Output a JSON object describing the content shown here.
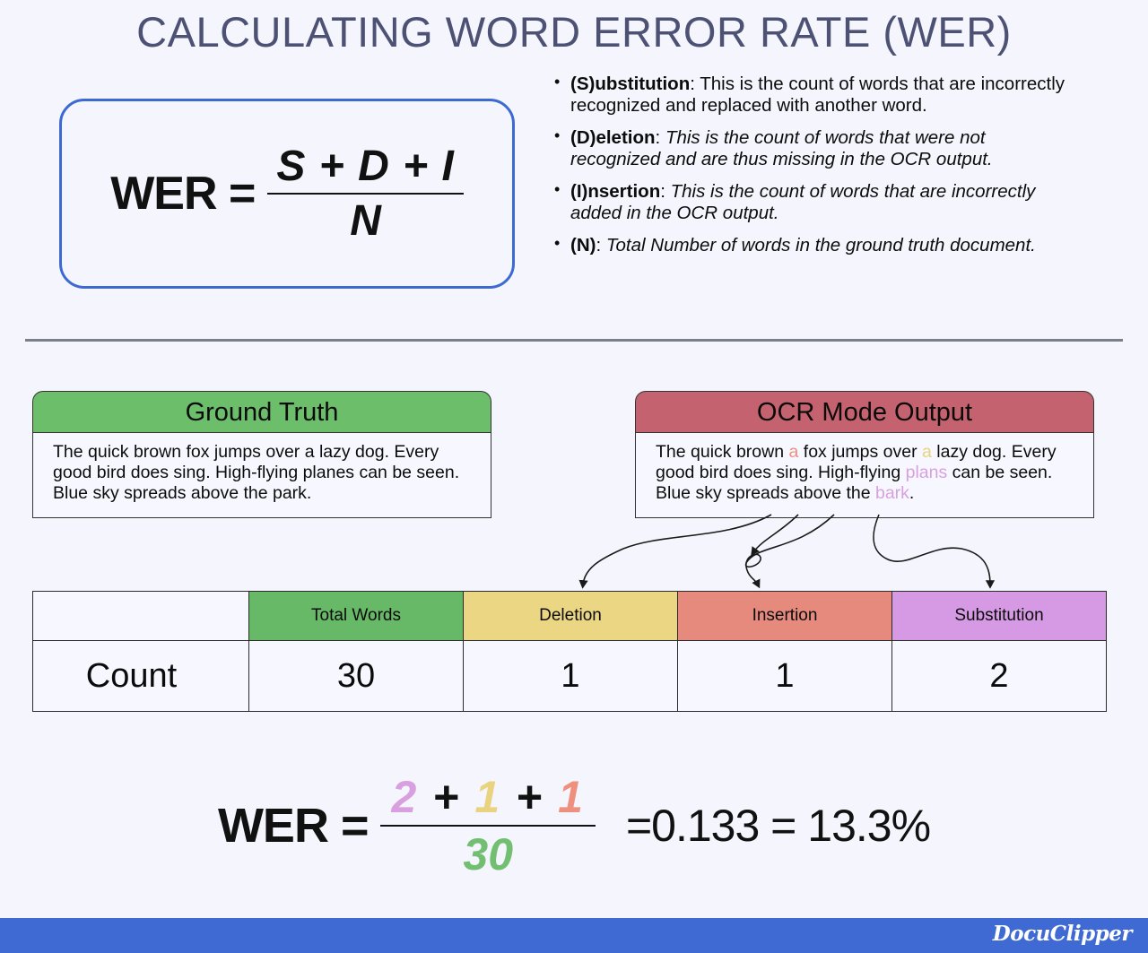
{
  "title": "CALCULATING WORD ERROR RATE (WER)",
  "formula": {
    "lhs": "WER =",
    "numerator": "S + D + I",
    "denominator": "N"
  },
  "definitions": [
    {
      "term": "(S)ubstitution",
      "sep": ": ",
      "desc": "This is the count of words that are incorrectly recognized and replaced with another word.",
      "italic": false
    },
    {
      "term": "(D)eletion",
      "sep": ": ",
      "desc": "This is the count of words that were not recognized and are thus missing in the OCR output.",
      "italic": true
    },
    {
      "term": "(I)nsertion",
      "sep": ": ",
      "desc": "This is the count of words that are incorrectly added in the OCR output.",
      "italic": true
    },
    {
      "term": "(N)",
      "sep": ": ",
      "desc": "Total Number of words in the ground truth document.",
      "italic": true
    }
  ],
  "ground_truth": {
    "header": "Ground Truth",
    "text": "The quick brown fox jumps over a lazy dog. Every good bird does sing. High-flying planes can be seen. Blue sky spreads above the park."
  },
  "ocr_output": {
    "header": "OCR Mode Output",
    "segments": [
      {
        "text": "The quick brown ",
        "type": "plain"
      },
      {
        "text": "a",
        "type": "insertion"
      },
      {
        "text": " fox jumps over ",
        "type": "plain"
      },
      {
        "text": "a",
        "type": "deletion"
      },
      {
        "text": " lazy dog. Every good bird does sing. High-flying ",
        "type": "plain"
      },
      {
        "text": "plans",
        "type": "substitution"
      },
      {
        "text": " can be seen. Blue sky spreads above the ",
        "type": "plain"
      },
      {
        "text": "bark",
        "type": "substitution"
      },
      {
        "text": ".",
        "type": "plain"
      }
    ]
  },
  "table": {
    "corner": "",
    "headers": [
      "Total Words",
      "Deletion",
      "Insertion",
      "Substitution"
    ],
    "row_label": "Count",
    "values": [
      "30",
      "1",
      "1",
      "2"
    ]
  },
  "result": {
    "lhs": "WER =",
    "num_sub": "2",
    "plus1": "+",
    "num_del": "1",
    "plus2": "+",
    "num_ins": "1",
    "denominator": "30",
    "value": "=0.133 = 13.3%"
  },
  "footer": {
    "logo": "DocuClipper"
  },
  "colors": {
    "title": "#4d5274",
    "background": "#f4f5fd",
    "formula_border": "#3c6ad0",
    "ground_truth_header": "#6cbe6a",
    "ocr_header": "#c4636f",
    "total_words": "#68b967",
    "deletion": "#ebd684",
    "insertion": "#e68a7e",
    "substitution": "#d69ae4",
    "footer": "#3f6ad4"
  }
}
